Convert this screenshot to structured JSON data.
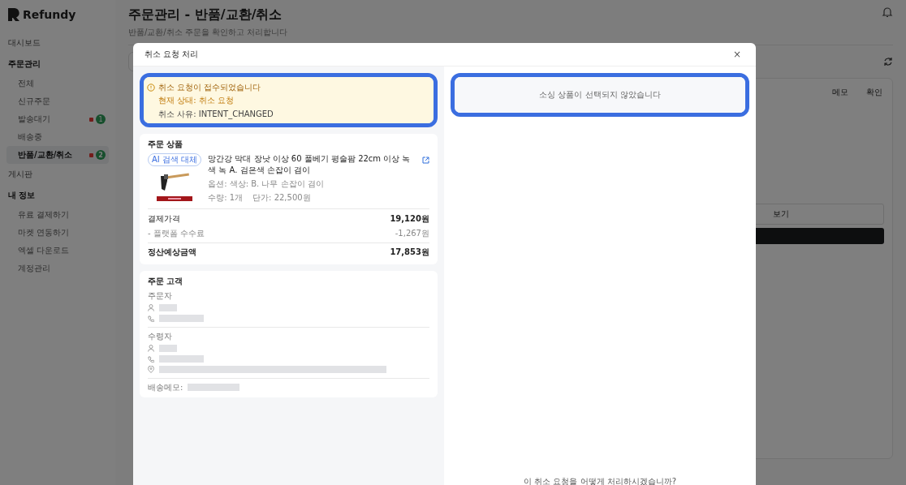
{
  "brand": {
    "name": "Refundy"
  },
  "sidebar": {
    "items": [
      {
        "label": "대시보드"
      },
      {
        "label": "주문관리",
        "children": [
          {
            "label": "전체",
            "selected": false
          },
          {
            "label": "신규주문",
            "selected": false
          },
          {
            "label": "발송대기",
            "selected": false,
            "badge": "1"
          },
          {
            "label": "배송중",
            "selected": false
          },
          {
            "label": "반품/교환/취소",
            "selected": true,
            "badge": "2"
          }
        ]
      },
      {
        "label": "게시판"
      },
      {
        "label": "내 정보",
        "children": [
          {
            "label": "유료 결제하기",
            "selected": false
          },
          {
            "label": "마켓 연동하기",
            "selected": false
          },
          {
            "label": "엑셀 다운로드",
            "selected": false
          },
          {
            "label": "계정관리",
            "selected": false
          }
        ]
      }
    ]
  },
  "page": {
    "title": "주문관리 - 반품/교환/취소",
    "subtitle": "반품/교환/취소 주문을 확인하고 처리합니다"
  },
  "background_table": {
    "columns": [
      "메모",
      "확인"
    ],
    "button": "보기"
  },
  "modal": {
    "title": "취소 요청 처리",
    "close": "×",
    "alert": {
      "title": "취소 요청이 접수되었습니다",
      "status": "현재 상태: 취소 요청",
      "reason": "취소 사유: INTENT_CHANGED"
    },
    "product_card": {
      "title": "주문 상품",
      "tag": "AI 검색 대체",
      "name": "망간강 막대 장낫 이상 60 풀베기 평술팜 22cm 이상 녹색 녹 A. 검은색 손잡이 겸이",
      "option": "옵션: 색상: B. 나무 손잡이 겸이",
      "quantity": "수량: 1개",
      "unit_price": "단가: 22,500원",
      "rows": [
        {
          "label": "결제가격",
          "value": "19,120원",
          "kind": "normal"
        },
        {
          "label": "- 플랫폼 수수료",
          "value": "-1,267원",
          "kind": "minor"
        },
        {
          "label": "정산예상금액",
          "value": "17,853원",
          "kind": "total"
        }
      ]
    },
    "customer_card": {
      "title": "주문 고객",
      "groups": [
        {
          "label": "주문자",
          "lines": [
            {
              "kind": "person"
            },
            {
              "kind": "phone"
            }
          ]
        },
        {
          "label": "수령자",
          "lines": [
            {
              "kind": "person"
            },
            {
              "kind": "phone"
            },
            {
              "kind": "address"
            }
          ]
        }
      ],
      "memo_label": "배송메모:"
    },
    "empty_panel": "소싱 상품이 선택되지 않았습니다",
    "question": "이 취소 요청을 어떻게 처리하시겠습니까?"
  }
}
